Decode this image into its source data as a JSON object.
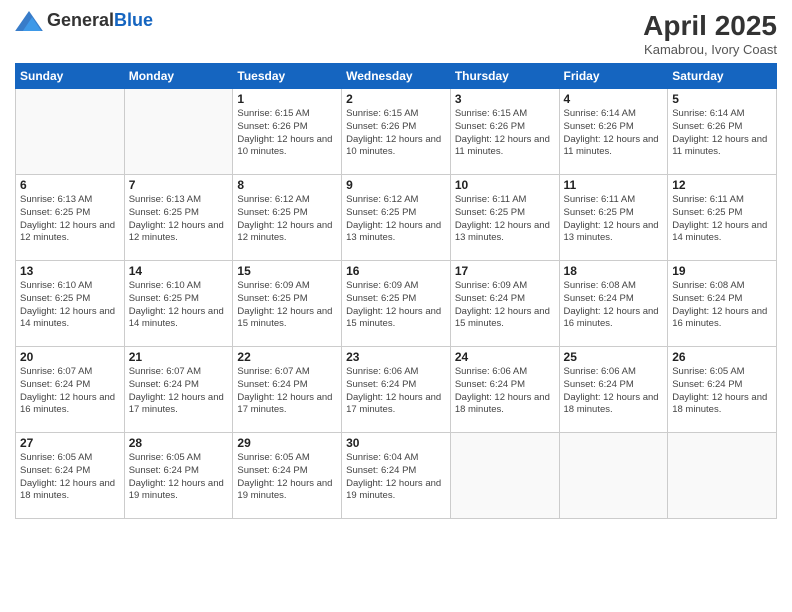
{
  "header": {
    "logo_general": "General",
    "logo_blue": "Blue",
    "month_year": "April 2025",
    "location": "Kamabrou, Ivory Coast"
  },
  "days_of_week": [
    "Sunday",
    "Monday",
    "Tuesday",
    "Wednesday",
    "Thursday",
    "Friday",
    "Saturday"
  ],
  "weeks": [
    [
      {
        "day": "",
        "info": ""
      },
      {
        "day": "",
        "info": ""
      },
      {
        "day": "1",
        "info": "Sunrise: 6:15 AM\nSunset: 6:26 PM\nDaylight: 12 hours and 10 minutes."
      },
      {
        "day": "2",
        "info": "Sunrise: 6:15 AM\nSunset: 6:26 PM\nDaylight: 12 hours and 10 minutes."
      },
      {
        "day": "3",
        "info": "Sunrise: 6:15 AM\nSunset: 6:26 PM\nDaylight: 12 hours and 11 minutes."
      },
      {
        "day": "4",
        "info": "Sunrise: 6:14 AM\nSunset: 6:26 PM\nDaylight: 12 hours and 11 minutes."
      },
      {
        "day": "5",
        "info": "Sunrise: 6:14 AM\nSunset: 6:26 PM\nDaylight: 12 hours and 11 minutes."
      }
    ],
    [
      {
        "day": "6",
        "info": "Sunrise: 6:13 AM\nSunset: 6:25 PM\nDaylight: 12 hours and 12 minutes."
      },
      {
        "day": "7",
        "info": "Sunrise: 6:13 AM\nSunset: 6:25 PM\nDaylight: 12 hours and 12 minutes."
      },
      {
        "day": "8",
        "info": "Sunrise: 6:12 AM\nSunset: 6:25 PM\nDaylight: 12 hours and 12 minutes."
      },
      {
        "day": "9",
        "info": "Sunrise: 6:12 AM\nSunset: 6:25 PM\nDaylight: 12 hours and 13 minutes."
      },
      {
        "day": "10",
        "info": "Sunrise: 6:11 AM\nSunset: 6:25 PM\nDaylight: 12 hours and 13 minutes."
      },
      {
        "day": "11",
        "info": "Sunrise: 6:11 AM\nSunset: 6:25 PM\nDaylight: 12 hours and 13 minutes."
      },
      {
        "day": "12",
        "info": "Sunrise: 6:11 AM\nSunset: 6:25 PM\nDaylight: 12 hours and 14 minutes."
      }
    ],
    [
      {
        "day": "13",
        "info": "Sunrise: 6:10 AM\nSunset: 6:25 PM\nDaylight: 12 hours and 14 minutes."
      },
      {
        "day": "14",
        "info": "Sunrise: 6:10 AM\nSunset: 6:25 PM\nDaylight: 12 hours and 14 minutes."
      },
      {
        "day": "15",
        "info": "Sunrise: 6:09 AM\nSunset: 6:25 PM\nDaylight: 12 hours and 15 minutes."
      },
      {
        "day": "16",
        "info": "Sunrise: 6:09 AM\nSunset: 6:25 PM\nDaylight: 12 hours and 15 minutes."
      },
      {
        "day": "17",
        "info": "Sunrise: 6:09 AM\nSunset: 6:24 PM\nDaylight: 12 hours and 15 minutes."
      },
      {
        "day": "18",
        "info": "Sunrise: 6:08 AM\nSunset: 6:24 PM\nDaylight: 12 hours and 16 minutes."
      },
      {
        "day": "19",
        "info": "Sunrise: 6:08 AM\nSunset: 6:24 PM\nDaylight: 12 hours and 16 minutes."
      }
    ],
    [
      {
        "day": "20",
        "info": "Sunrise: 6:07 AM\nSunset: 6:24 PM\nDaylight: 12 hours and 16 minutes."
      },
      {
        "day": "21",
        "info": "Sunrise: 6:07 AM\nSunset: 6:24 PM\nDaylight: 12 hours and 17 minutes."
      },
      {
        "day": "22",
        "info": "Sunrise: 6:07 AM\nSunset: 6:24 PM\nDaylight: 12 hours and 17 minutes."
      },
      {
        "day": "23",
        "info": "Sunrise: 6:06 AM\nSunset: 6:24 PM\nDaylight: 12 hours and 17 minutes."
      },
      {
        "day": "24",
        "info": "Sunrise: 6:06 AM\nSunset: 6:24 PM\nDaylight: 12 hours and 18 minutes."
      },
      {
        "day": "25",
        "info": "Sunrise: 6:06 AM\nSunset: 6:24 PM\nDaylight: 12 hours and 18 minutes."
      },
      {
        "day": "26",
        "info": "Sunrise: 6:05 AM\nSunset: 6:24 PM\nDaylight: 12 hours and 18 minutes."
      }
    ],
    [
      {
        "day": "27",
        "info": "Sunrise: 6:05 AM\nSunset: 6:24 PM\nDaylight: 12 hours and 18 minutes."
      },
      {
        "day": "28",
        "info": "Sunrise: 6:05 AM\nSunset: 6:24 PM\nDaylight: 12 hours and 19 minutes."
      },
      {
        "day": "29",
        "info": "Sunrise: 6:05 AM\nSunset: 6:24 PM\nDaylight: 12 hours and 19 minutes."
      },
      {
        "day": "30",
        "info": "Sunrise: 6:04 AM\nSunset: 6:24 PM\nDaylight: 12 hours and 19 minutes."
      },
      {
        "day": "",
        "info": ""
      },
      {
        "day": "",
        "info": ""
      },
      {
        "day": "",
        "info": ""
      }
    ]
  ]
}
